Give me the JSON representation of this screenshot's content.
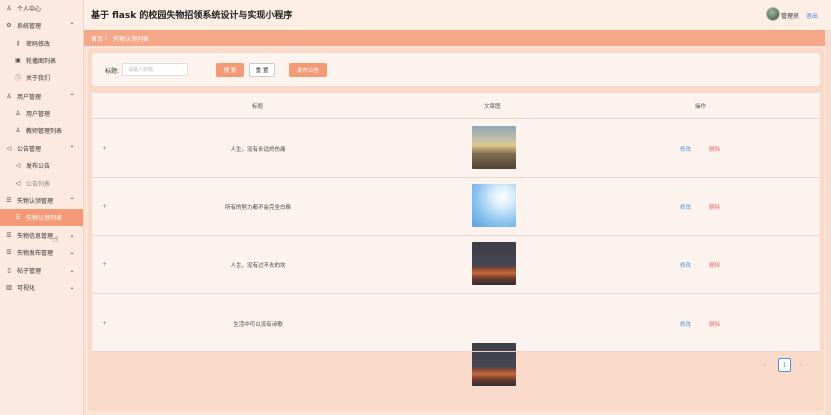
{
  "app": {
    "title": "基于 flask 的校园失物招领系统设计与实现小程序"
  },
  "user": {
    "name": "管理员",
    "logout_label": "退出"
  },
  "sidebar": {
    "items": [
      {
        "label": "个人中心",
        "icon": "user-icon"
      },
      {
        "label": "系统管理",
        "icon": "gear-icon",
        "chevron": "⌃"
      },
      {
        "label": "密码修改",
        "icon": "key-icon"
      },
      {
        "label": "轮播图列表",
        "icon": "image-icon"
      },
      {
        "label": "关于我们",
        "icon": "info-icon"
      },
      {
        "label": "用户管理",
        "icon": "users-icon",
        "chevron": "⌃"
      },
      {
        "label": "用户管理",
        "icon": "user-icon"
      },
      {
        "label": "教师管理列表",
        "icon": "user-icon"
      },
      {
        "label": "公告管理",
        "icon": "megaphone-icon",
        "chevron": "⌃"
      },
      {
        "label": "发布公告",
        "icon": "megaphone-icon"
      },
      {
        "label": "公告列表",
        "icon": "megaphone-icon"
      },
      {
        "label": "失物认领管理",
        "icon": "list-icon",
        "chevron": "⌃"
      },
      {
        "label": "失物认领列表",
        "icon": "list-icon"
      },
      {
        "label": "失物信息管理",
        "icon": "list-icon",
        "chevron": "⌄"
      },
      {
        "label": "失物发布管理",
        "icon": "list-icon",
        "chevron": "⌄"
      },
      {
        "label": "帖子管理",
        "icon": "document-icon",
        "chevron": "⌄"
      },
      {
        "label": "可视化",
        "icon": "chart-icon",
        "chevron": "⌄"
      }
    ]
  },
  "breadcrumb": {
    "home": "首页",
    "separator": "/",
    "current": "失物认领列表"
  },
  "search": {
    "label": "标题:",
    "placeholder": "请输入标题",
    "search_button": "搜 索",
    "reset_button": "重 置",
    "publish_button": "发布公告"
  },
  "table": {
    "headers": {
      "title": "标题",
      "image": "文章图",
      "actions": "操作"
    },
    "rows": [
      {
        "expand": "+",
        "title": "人生，没有永远的伤痛",
        "image": "road-photo"
      },
      {
        "expand": "+",
        "title": "所有的努力都不会完全白费",
        "image": "sky-photo"
      },
      {
        "expand": "+",
        "title": "人生，没有过不去的坎",
        "image": "book-cover"
      },
      {
        "expand": "+",
        "title": "生活中可以没有诗歌",
        "image": "book-cover"
      }
    ],
    "edit_label": "修改",
    "delete_label": "删除"
  },
  "pagination": {
    "prev": "‹",
    "current": "1",
    "next": "›"
  },
  "colors": {
    "accent": "#f49a76",
    "link": "#4a90e2",
    "danger": "#e86c6c",
    "background": "#fbe3d6"
  }
}
